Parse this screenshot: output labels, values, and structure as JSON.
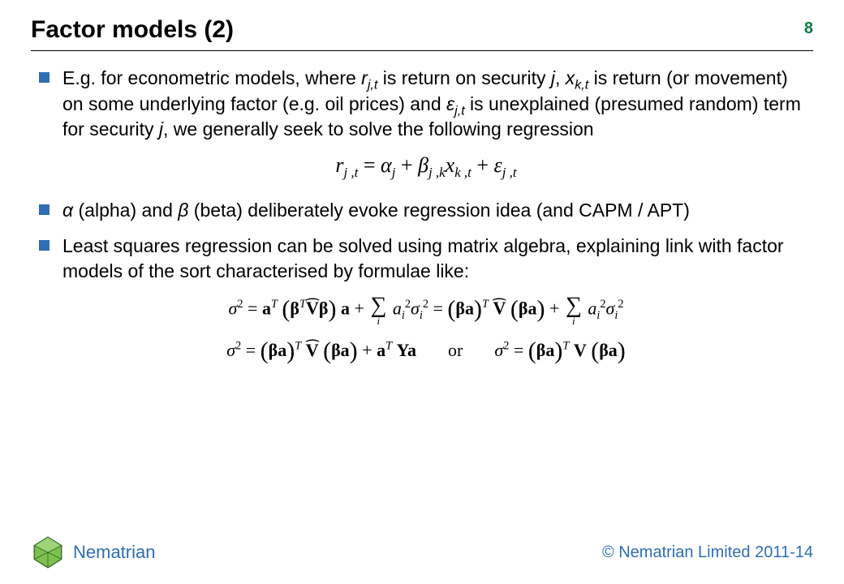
{
  "header": {
    "title": "Factor models (2)",
    "page_number": "8"
  },
  "bullets": [
    {
      "pre": "E.g. for econometric models, where ",
      "v1": "r",
      "v1sub": "j,t",
      "mid1": " is return on security ",
      "v2": "j",
      "mid2": ", ",
      "v3": "x",
      "v3sub": "k,t",
      "mid3": " is return (or movement) on some underlying factor (e.g. oil prices) and ",
      "v4": "ε",
      "v4sub": "j,t",
      "post": " is unexplained (presumed random) term for security ",
      "v5": "j",
      "tail": ", we generally seek to solve the following regression"
    },
    {
      "sym1": "α",
      "mid1": " (alpha) and ",
      "sym2": "β",
      "mid2": " (beta) deliberately evoke regression idea (and CAPM / APT)"
    },
    {
      "text": "Least squares regression can be solved using matrix algebra, explaining link with factor models of the sort characterised by formulae like:"
    }
  ],
  "eq1": {
    "r": "r",
    "rsub": "j ,t",
    "eq": " = ",
    "a": "α",
    "asub": "j",
    "plus1": " + ",
    "b": "β",
    "bsub": "j ,k",
    "x": "x",
    "xsub": "k ,t",
    "plus2": " + ",
    "e": "ε",
    "esub": "j ,t"
  },
  "eq2": {
    "sig": "σ",
    "two": "2",
    "eq": " = ",
    "aT": "a",
    "T": "T",
    "beta": "β",
    "V": "V",
    "plus": " + ",
    "sum": "∑",
    "i": "i",
    "ai": "a",
    "sigi": "σ",
    "eqmid": " = ",
    "or": "or",
    "Y": "Y"
  },
  "footer": {
    "brand": "Nematrian",
    "copyright": "© Nematrian Limited 2011-14"
  }
}
